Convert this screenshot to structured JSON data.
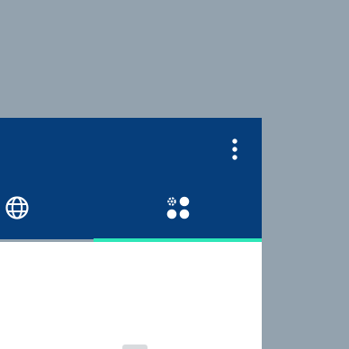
{
  "screen": {
    "background_color": "#93a2ae"
  },
  "app_bar": {
    "color": "#063e7b",
    "actions": [
      {
        "icon": "more-vert-icon"
      }
    ],
    "tabs": [
      {
        "icon": "globe-icon",
        "selected": false
      },
      {
        "icon": "apps-settings-icon",
        "selected": true
      }
    ],
    "indicator_color": "#2ee6b8"
  },
  "content": {
    "background_color": "#ffffff"
  }
}
